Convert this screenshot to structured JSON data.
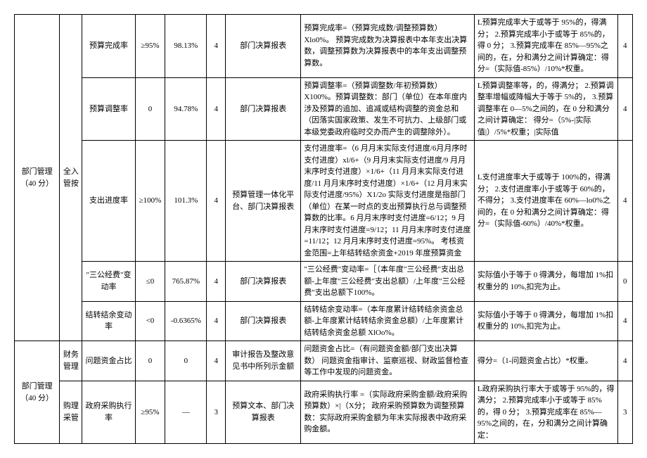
{
  "rows": [
    {
      "cat": "部门管理（40 分）",
      "sub": "全入管按",
      "indicator": "预算完成率",
      "standard": "≥95%",
      "value": "98.13%",
      "weight": "4",
      "source": "部门决算报表",
      "explain": "预算完成率=（预算完成数/调整预算数）Xlo0%。\n预算完成数为决算报表中本年支出决算数，调整预算数为决算报表中的本年支出调整预算数。",
      "rule": "L预算完成率大于或等于 95%的，得满分；\n2.预算完成率小于或等于 85%的，得 0 分；\n3.预算完成率在 85%—95%之间的，在，分和满分之间计算确定：得分=（实际值-85%）/10%*权重。",
      "score": "4"
    },
    {
      "indicator": "预算调整率",
      "standard": "0",
      "value": "94.78%",
      "weight": "4",
      "source": "部门决算报表",
      "explain": "预算调整率=（预算调整数/年初预算数）X100%。预算调整数：部门（单位）在本年度内涉及预算的追加、追减或结构调整的资金总和（因落实国家政策、发生不可抗力、上级部门或本级党委政府临时交办而产生的调整除外）。",
      "rule": "L预算调整率等，的，得满分；\n2.预算调整率增幅或降幅大于等于 5%的，\n3.预算调整率在 0—5%之间的，在 0 分和满分之间计算确定：\n得分=（5%-|实际值|）/5%*权重；|实际值",
      "score": "4"
    },
    {
      "indicator": "支出进度率",
      "standard": "≥100%",
      "value": "101.3%",
      "weight": "4",
      "source": "预算管理一体化平台、部门决算报表",
      "explain": "支付进度率=（6 月月末实际支付进度/6月月序时支付进度）xl/6+（9 月月末实际支付进度/9 月月末序时支付进度）×1/6+（11 月月末实际支付进度/11 月月末序时支付进度）×1/6+（12 月月末实际支付进度/95%）X1/2o\n实际支付进度是指部门（单位）在某一时点的支出预算执行总与调整预算数的比率。6 月月末序时支付进度=6/12；9 月月末序时支付进度=9/12；11 月月末序时支付进度=11/12；12 月月末序时支付进度=95%。\n考核资金范围=上年结转结余资金+2019 年度预算资金",
      "rule": "L支付进度率大于或等于 100%的，得满分；\n2.支付进度率小于或等于 60%的，不得分；\n3.支付进度率在 60%—lo0%之间的，在 0 分和满分之间计算确定：得分=（实际值-60%）/40%*权重。",
      "score": "4"
    },
    {
      "indicator": "\"三公经费\"变动率",
      "standard": "≤0",
      "value": "765.87%",
      "weight": "4",
      "source": "部门决算报表",
      "explain": "\"三公经费\"变动率=［（本年度\"三公经费\"支出总额-上年度\"三公经费\"支出总额）/上年度\"三公经费\"支出总额下100%。",
      "rule": "实际值小于等于 0 得满分，每增加 1%扣权重分的 10%,扣完为止。",
      "score": "0"
    },
    {
      "indicator": "结转结余变动率",
      "standard": "<0",
      "value": "-0.6365%",
      "weight": "4",
      "source": "部门决算报表",
      "explain": "结转结余变动率=（本年度累计结转结余资金总额-上年度累计结转结余资金总额）/上年度累计结转结余资金总额 XlOo%。",
      "rule": "实际值小于等于 0 得满分，每增加 1%扣权重分的 10%,扣完为止。",
      "score": "4"
    },
    {
      "cat": "部门管理（40 分）",
      "sub": "财务管理",
      "indicator": "问题资金占比",
      "standard": "0",
      "value": "0",
      "weight": "4",
      "source": "审计报告及整改意见书中所列示金额",
      "explain": "问题资金占比=（有问题资金额/部门支出决算数）\n问题资金指审计、监察巡视、财政监督检查等工作中发现的问题资金。",
      "rule": "得分=（1-问题资金占比）*权重。",
      "score": "4"
    },
    {
      "sub": "购理采管",
      "indicator": "政府采购执行率",
      "standard": "≥95%",
      "value": "—",
      "weight": "3",
      "source": "预算文本、部门决算报表",
      "explain": "政府采购执行率 =（实际政府采购金额/政府采购预算数）×|（X分；\n政府采购预算数为调整预算数：实际政府采购金额为年末实际报表中政府采购金额。",
      "rule": "L政府采购执行率大于或等于 95%的，得满分；\n2.预算完成率小于或等于 85%的，得 0 分；\n3.预算完成率在 85%—95%之间的，在，分和满分之间计算确定：",
      "score": "3"
    }
  ]
}
